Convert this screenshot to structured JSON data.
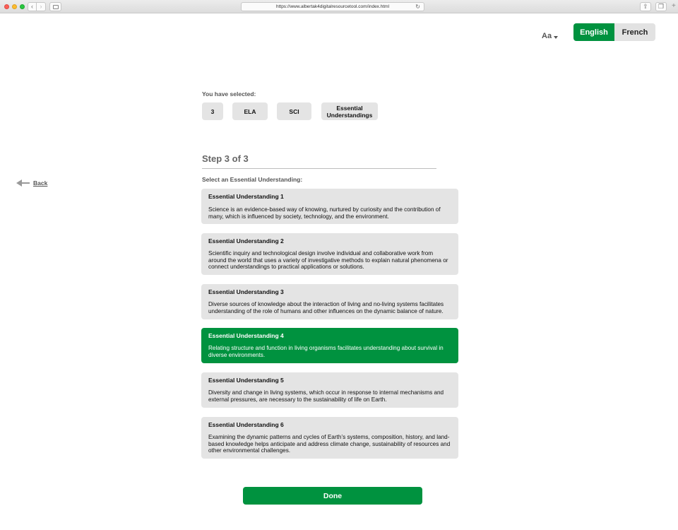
{
  "browser": {
    "url": "https://www.albertak4digitalresourcetool.com/index.html"
  },
  "header": {
    "font_size_label": "Aa",
    "languages": [
      {
        "label": "English",
        "active": true
      },
      {
        "label": "French",
        "active": false
      }
    ]
  },
  "nav": {
    "back_label": "Back"
  },
  "selection": {
    "label": "You have selected:",
    "chips": [
      "3",
      "ELA",
      "SCI",
      "Essential Understandings"
    ]
  },
  "step": {
    "title": "Step 3 of 3",
    "prompt": "Select an Essential Understanding:"
  },
  "understandings": [
    {
      "title": "Essential Understanding 1",
      "text": "Science is an evidence-based way of knowing, nurtured by curiosity and the contribution of many, which is influenced by society, technology, and the environment.",
      "selected": false
    },
    {
      "title": "Essential Understanding 2",
      "text": "Scientific inquiry and technological design involve individual and collaborative work from around the world that uses a variety of investigative methods to explain natural phenomena or connect understandings to practical applications or solutions.",
      "selected": false
    },
    {
      "title": "Essential Understanding 3",
      "text": "Diverse sources of knowledge about the interaction of living and no-living systems  facilitates understanding of the role of humans and other influences on the dynamic balance of nature.",
      "selected": false
    },
    {
      "title": "Essential Understanding 4",
      "text": "Relating structure and function in living organisms facilitates understanding about survival  in diverse environments.",
      "selected": true
    },
    {
      "title": "Essential Understanding 5",
      "text": "Diversity and change in living systems, which occur in response to internal mechanisms and external pressures, are necessary to the sustainability of life on Earth.",
      "selected": false
    },
    {
      "title": "Essential Understanding 6",
      "text": "Examining the dynamic patterns and cycles of Earth’s systems, composition, history, and land-based knowledge helps anticipate and address climate change, sustainability of resources and other environmental challenges.",
      "selected": false
    }
  ],
  "footer": {
    "done_label": "Done"
  },
  "colors": {
    "accent": "#00923f",
    "card_bg": "#e4e4e4"
  }
}
